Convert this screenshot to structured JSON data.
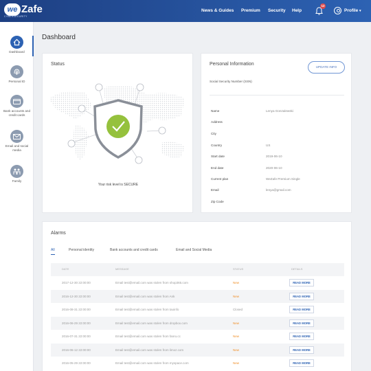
{
  "app": {
    "logo_we": "we",
    "logo_zafe": "Zafe",
    "logo_sub": "CYBERSECURITY",
    "brand_color": "#2d62b3"
  },
  "topnav": {
    "items": [
      "News & Guides",
      "Premium",
      "Security",
      "Help"
    ],
    "notifications_count": "12",
    "profile_label": "Profile"
  },
  "sidebar": {
    "items": [
      {
        "label": "Dashboard",
        "icon": "home-icon",
        "active": true
      },
      {
        "label": "Personal ID",
        "icon": "fingerprint-icon",
        "active": false
      },
      {
        "label": "Bank accounts and credit cards",
        "icon": "credit-card-icon",
        "active": false
      },
      {
        "label": "Email and social media",
        "icon": "envelope-icon",
        "active": false
      },
      {
        "label": "Family",
        "icon": "family-icon",
        "active": false
      }
    ]
  },
  "main": {
    "page_title": "Dashboard",
    "status": {
      "title": "Status",
      "message": "Your risk level is SECURE"
    },
    "personal_info": {
      "title": "Personal Information",
      "update_label": "UPDATE INFO",
      "ssn_label": "Social Security Number (SSN)",
      "rows": [
        {
          "label": "Name",
          "value": "Lenya Gonzalewski"
        },
        {
          "label": "Address",
          "value": ""
        },
        {
          "label": "City",
          "value": ""
        },
        {
          "label": "Country",
          "value": "US"
        },
        {
          "label": "Start date",
          "value": "2019-06-10"
        },
        {
          "label": "End date",
          "value": "2020-06-10"
        },
        {
          "label": "Current plan",
          "value": "WeZafe Premium Single"
        },
        {
          "label": "Email",
          "value": "lenya@gmail.com"
        },
        {
          "label": "Zip Code",
          "value": ""
        }
      ]
    },
    "alarms": {
      "title": "Alarms",
      "tabs": [
        "All",
        "Personal identity",
        "Bank accounts and credit cards",
        "Email and Social Media"
      ],
      "columns": [
        "DATE",
        "MESSAGE",
        "STATUS",
        "DETAILS"
      ],
      "rows": [
        {
          "date": "2017-12-30 22:00:00",
          "message": "Email test@email.com was stolen from shop365.com",
          "status": "New",
          "details": "READ MORE"
        },
        {
          "date": "2016-12-30 22:00:00",
          "message": "Email test@email.com was stolen from Ank",
          "status": "New",
          "details": "READ MORE"
        },
        {
          "date": "2016-08-31 22:00:00",
          "message": "Email test@email.com was stolen from taoinfo",
          "status": "Closed",
          "details": "READ MORE"
        },
        {
          "date": "2016-06-29 22:00:00",
          "message": "Email test@email.com was stolen from dropbox.com",
          "status": "New",
          "details": "READ MORE"
        },
        {
          "date": "2016-07-31 22:00:00",
          "message": "Email test@email.com was stolen from fanru.cc",
          "status": "New",
          "details": "READ MORE"
        },
        {
          "date": "2016-06-12 22:00:00",
          "message": "Email test@email.com was stolen from limoz.com",
          "status": "New",
          "details": "READ MORE"
        },
        {
          "date": "2016-05-29 22:00:00",
          "message": "Email test@email.com was stolen from myspace.com",
          "status": "New",
          "details": "READ MORE"
        }
      ]
    }
  }
}
